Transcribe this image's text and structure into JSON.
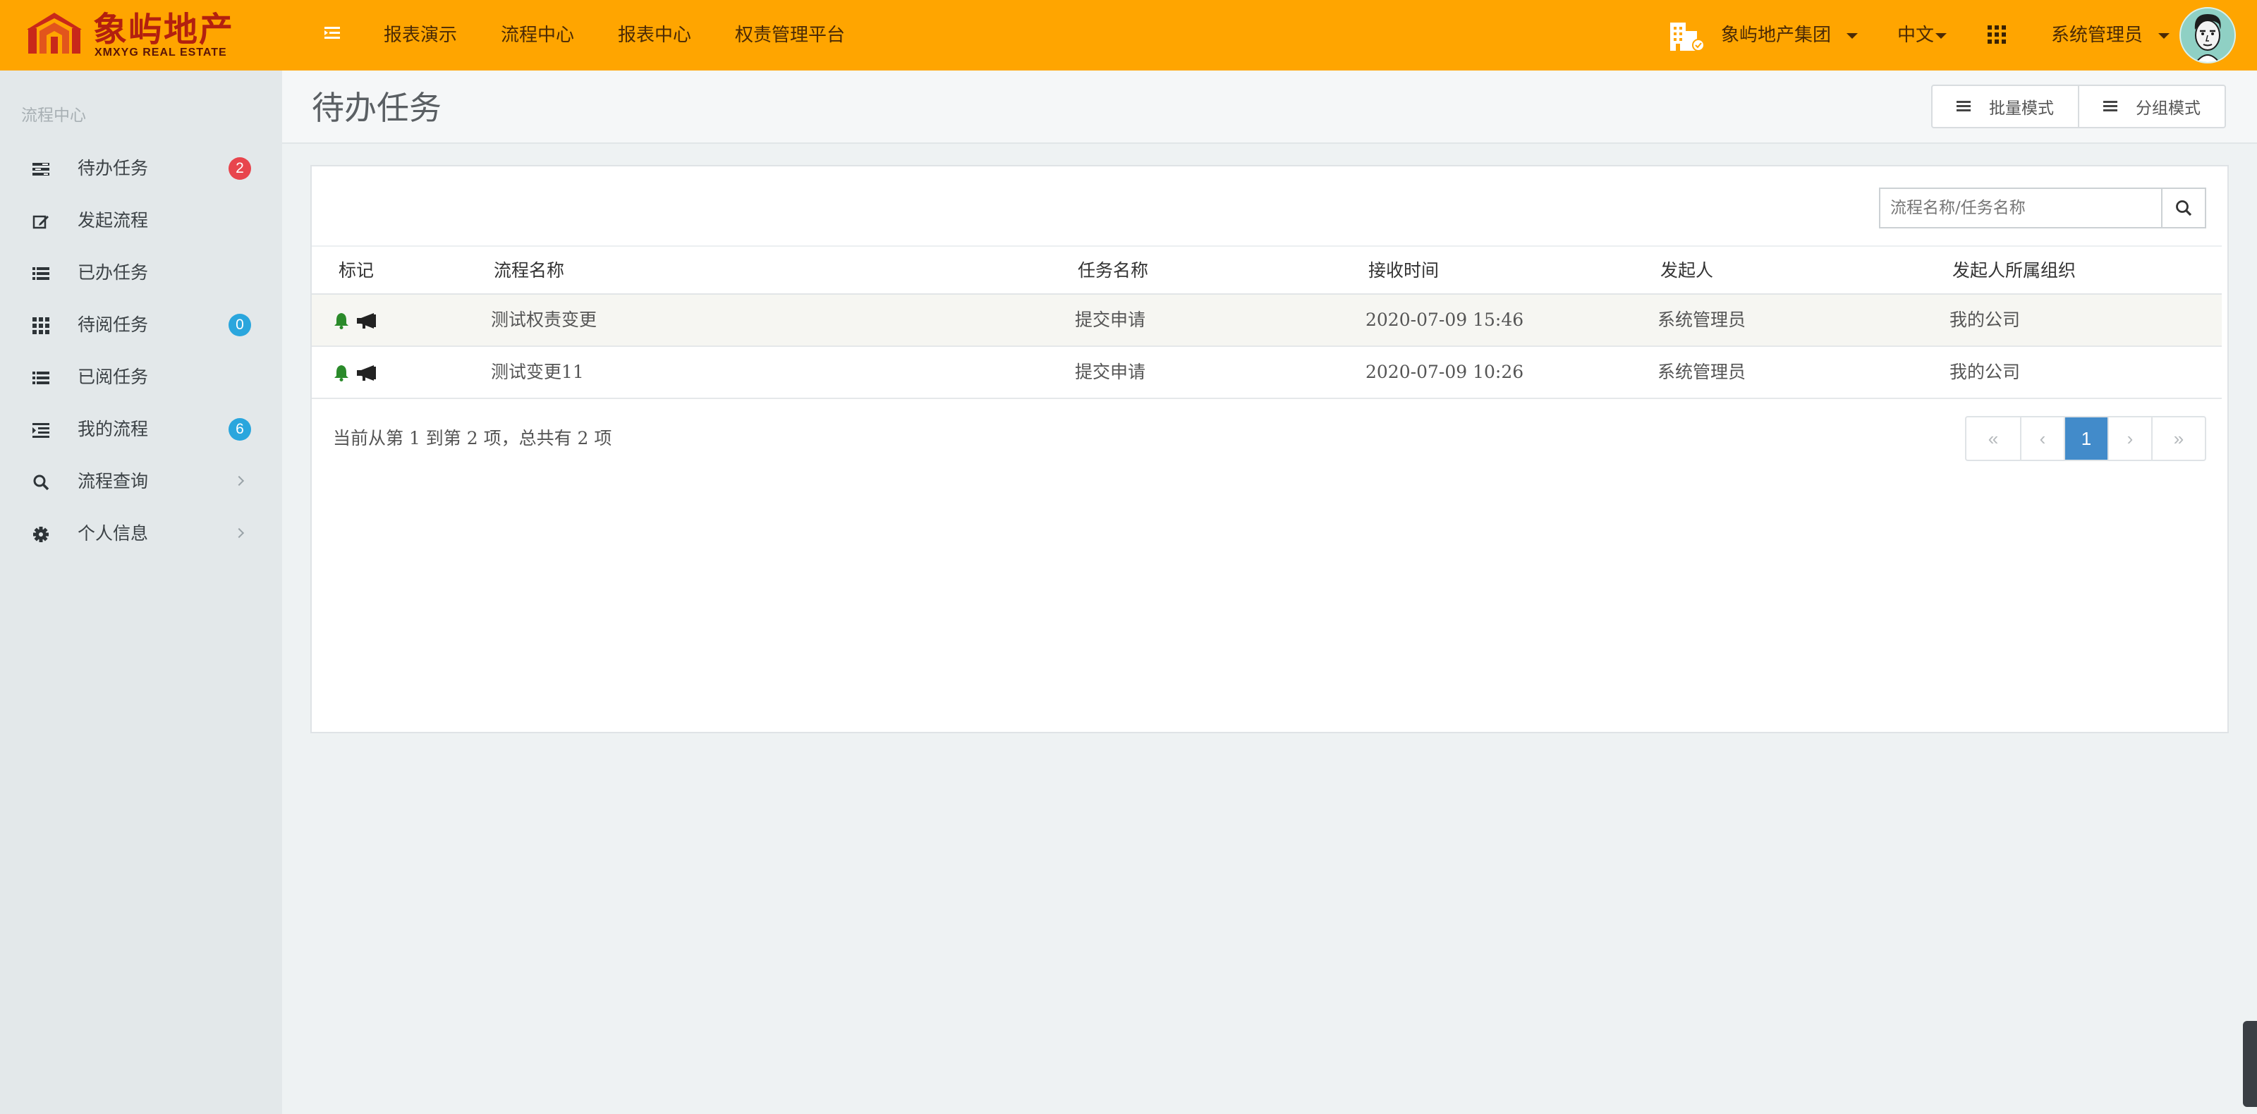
{
  "brand": {
    "name_cn": "象屿地产",
    "name_en": "XMXYG REAL ESTATE",
    "logo_color": "#b3200f"
  },
  "colors": {
    "topbar": "#ffa500",
    "badge_red": "#e8454d",
    "badge_blue": "#2aa6dd",
    "pager_active": "#428bca",
    "mark_green": "#2a8a2a"
  },
  "topnav": {
    "menu_icon": "menu-toggle-icon",
    "items": [
      "报表演示",
      "流程中心",
      "报表中心",
      "权责管理平台"
    ]
  },
  "header_right": {
    "org": "象屿地产集团",
    "lang": "中文",
    "apps_icon": "grid-icon",
    "user": "系统管理员"
  },
  "sidebar": {
    "title": "流程中心",
    "items": [
      {
        "label": "待办任务",
        "icon": "tasks-icon",
        "badge": "2",
        "badge_color": "#e8454d"
      },
      {
        "label": "发起流程",
        "icon": "edit-icon"
      },
      {
        "label": "已办任务",
        "icon": "list-icon"
      },
      {
        "label": "待阅任务",
        "icon": "grid-icon",
        "badge": "0",
        "badge_color": "#2aa6dd"
      },
      {
        "label": "已阅任务",
        "icon": "list-icon"
      },
      {
        "label": "我的流程",
        "icon": "indent-list-icon",
        "badge": "6",
        "badge_color": "#2aa6dd"
      },
      {
        "label": "流程查询",
        "icon": "search-icon",
        "expandable": true
      },
      {
        "label": "个人信息",
        "icon": "gear-icon",
        "expandable": true
      }
    ]
  },
  "page": {
    "title": "待办任务",
    "batch_mode": "批量模式",
    "group_mode": "分组模式"
  },
  "search": {
    "placeholder": "流程名称/任务名称",
    "icon": "search-icon"
  },
  "table": {
    "columns": [
      "标记",
      "流程名称",
      "任务名称",
      "接收时间",
      "发起人",
      "发起人所属组织"
    ],
    "rows": [
      {
        "mark": [
          "bell-icon",
          "bullhorn-icon"
        ],
        "process": "测试权责变更",
        "task": "提交申请",
        "time": "2020-07-09 15:46",
        "initiator": "系统管理员",
        "org": "我的公司"
      },
      {
        "mark": [
          "bell-icon",
          "bullhorn-icon"
        ],
        "process": "测试变更11",
        "task": "提交申请",
        "time": "2020-07-09 10:26",
        "initiator": "系统管理员",
        "org": "我的公司"
      }
    ]
  },
  "pagination": {
    "summary": "当前从第 1 到第 2 项，总共有 2 项",
    "first": "«",
    "prev": "‹",
    "current": "1",
    "next": "›",
    "last": "»"
  }
}
